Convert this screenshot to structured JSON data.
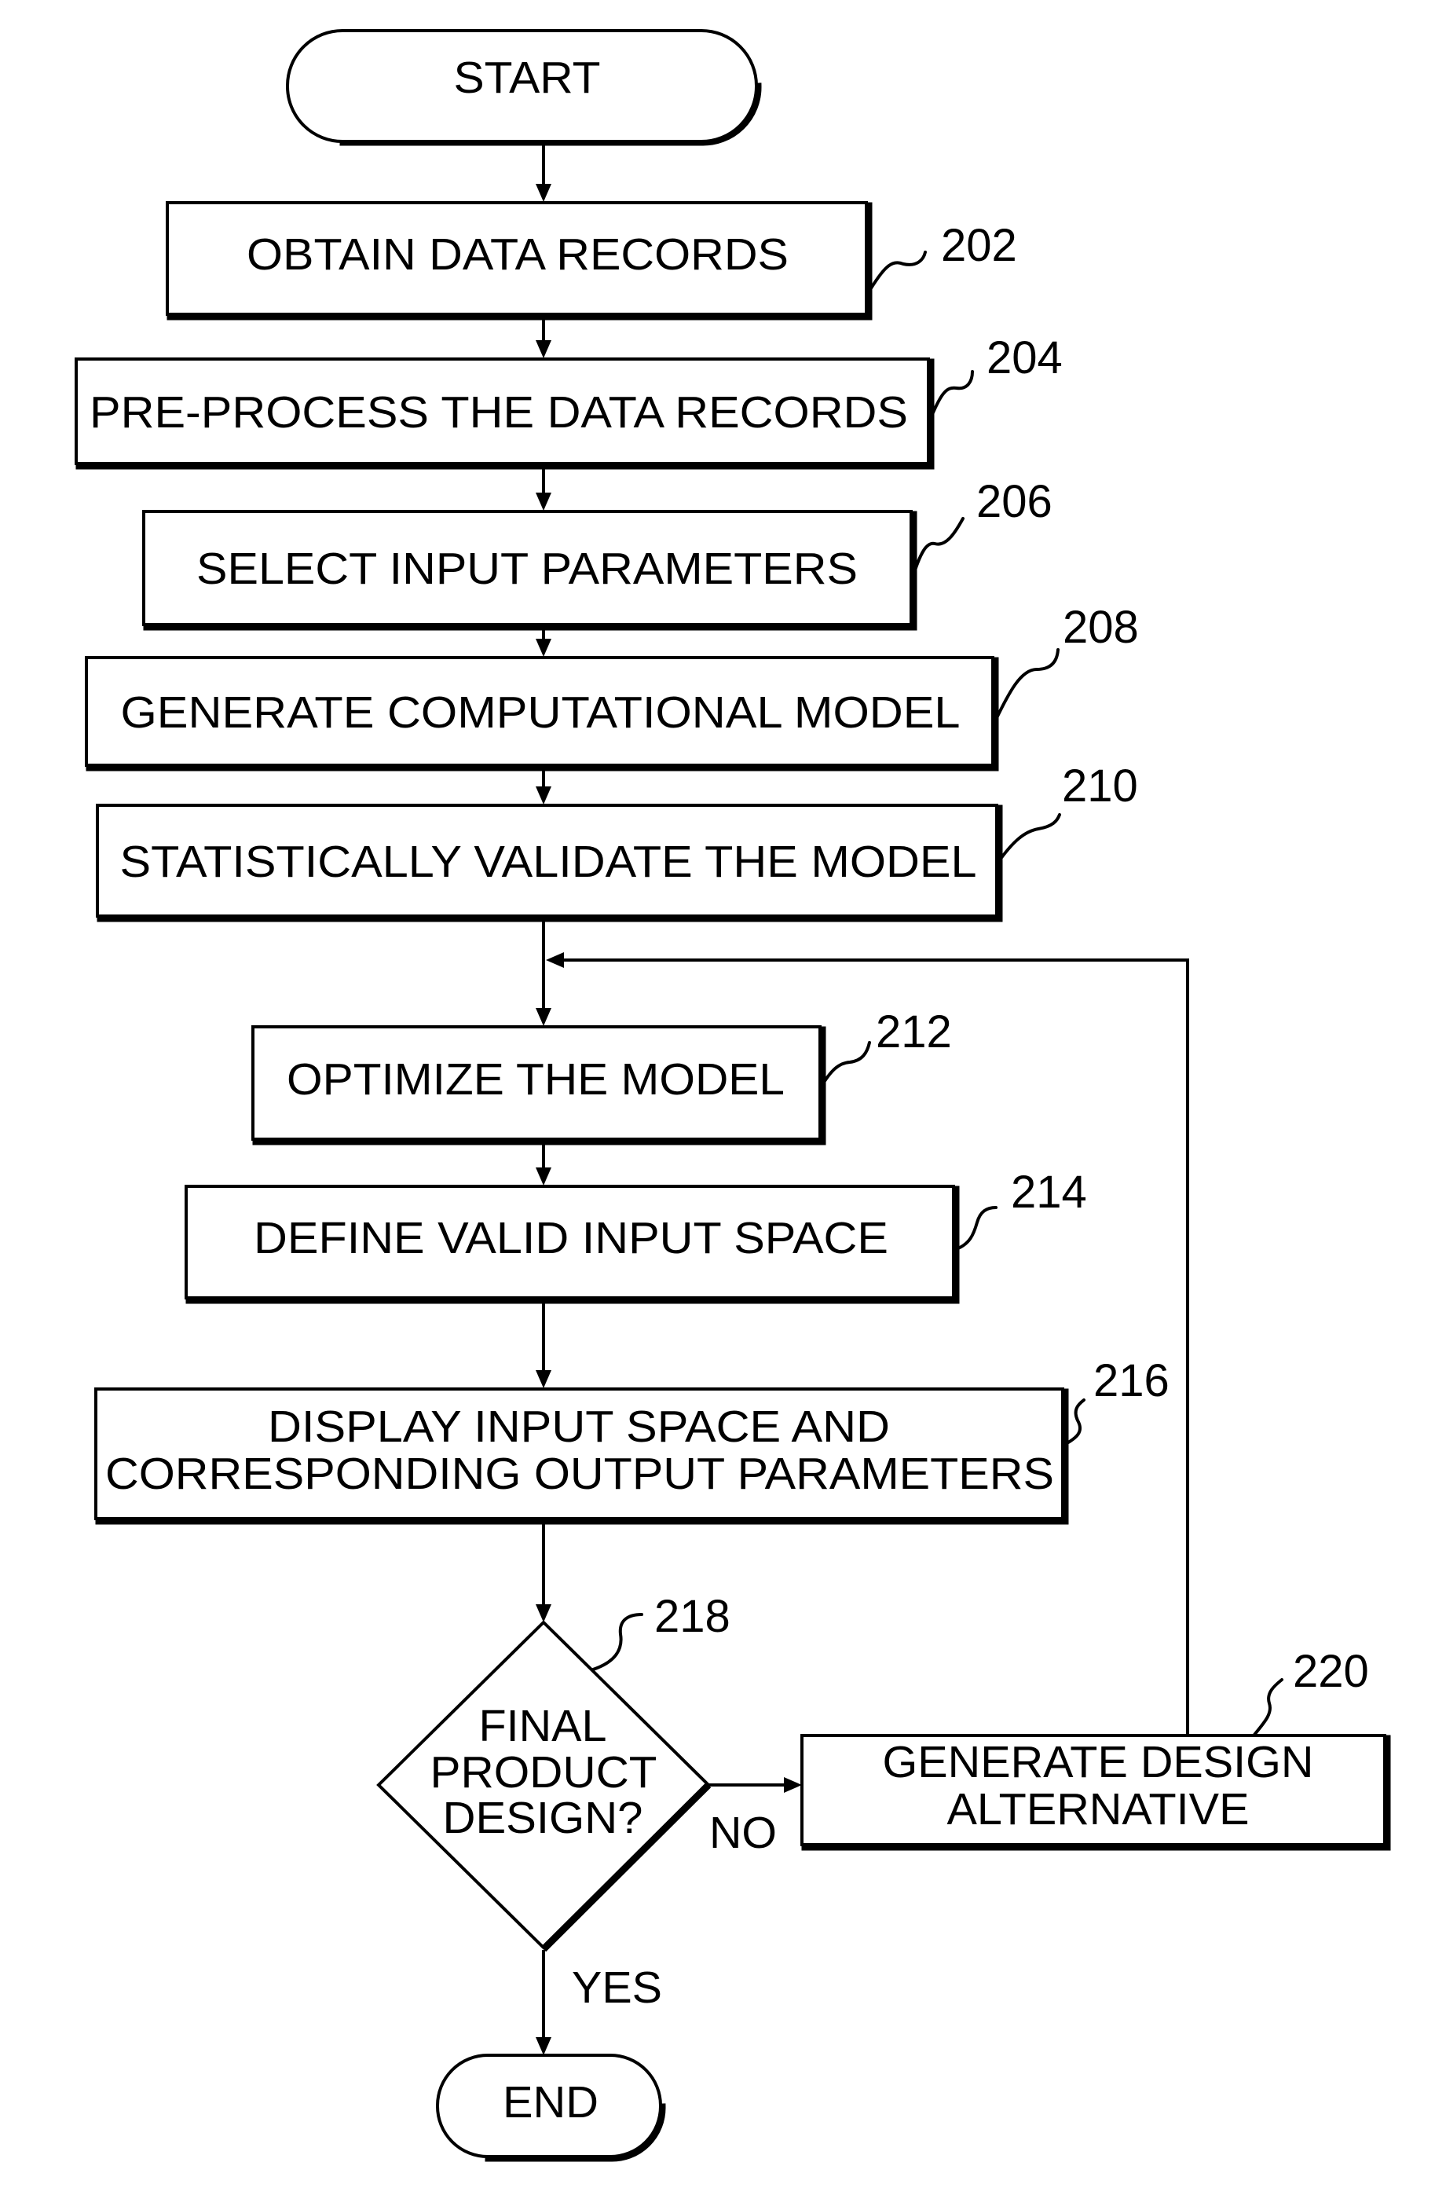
{
  "diagram": {
    "type": "flowchart",
    "terminals": {
      "start": "START",
      "end": "END"
    },
    "steps": [
      {
        "ref": "202",
        "lines": [
          "OBTAIN DATA RECORDS"
        ]
      },
      {
        "ref": "204",
        "lines": [
          "PRE-PROCESS THE DATA RECORDS"
        ]
      },
      {
        "ref": "206",
        "lines": [
          "SELECT INPUT PARAMETERS"
        ]
      },
      {
        "ref": "208",
        "lines": [
          "GENERATE COMPUTATIONAL MODEL"
        ]
      },
      {
        "ref": "210",
        "lines": [
          "STATISTICALLY VALIDATE THE MODEL"
        ]
      },
      {
        "ref": "212",
        "lines": [
          "OPTIMIZE THE MODEL"
        ]
      },
      {
        "ref": "214",
        "lines": [
          "DEFINE VALID INPUT SPACE"
        ]
      },
      {
        "ref": "216",
        "lines": [
          "DISPLAY INPUT SPACE AND",
          "CORRESPONDING OUTPUT PARAMETERS"
        ]
      }
    ],
    "decision": {
      "ref": "218",
      "lines": [
        "FINAL",
        "PRODUCT",
        "DESIGN?"
      ],
      "yes_label": "YES",
      "no_label": "NO"
    },
    "alternative": {
      "ref": "220",
      "lines": [
        "GENERATE DESIGN",
        "ALTERNATIVE"
      ]
    },
    "edges": [
      {
        "from": "START",
        "to": "202"
      },
      {
        "from": "202",
        "to": "204"
      },
      {
        "from": "204",
        "to": "206"
      },
      {
        "from": "206",
        "to": "208"
      },
      {
        "from": "208",
        "to": "210"
      },
      {
        "from": "210",
        "to": "212"
      },
      {
        "from": "212",
        "to": "214"
      },
      {
        "from": "214",
        "to": "216"
      },
      {
        "from": "216",
        "to": "218"
      },
      {
        "from": "218",
        "to": "END",
        "label": "YES"
      },
      {
        "from": "218",
        "to": "220",
        "label": "NO"
      },
      {
        "from": "220",
        "to": "212"
      }
    ]
  }
}
